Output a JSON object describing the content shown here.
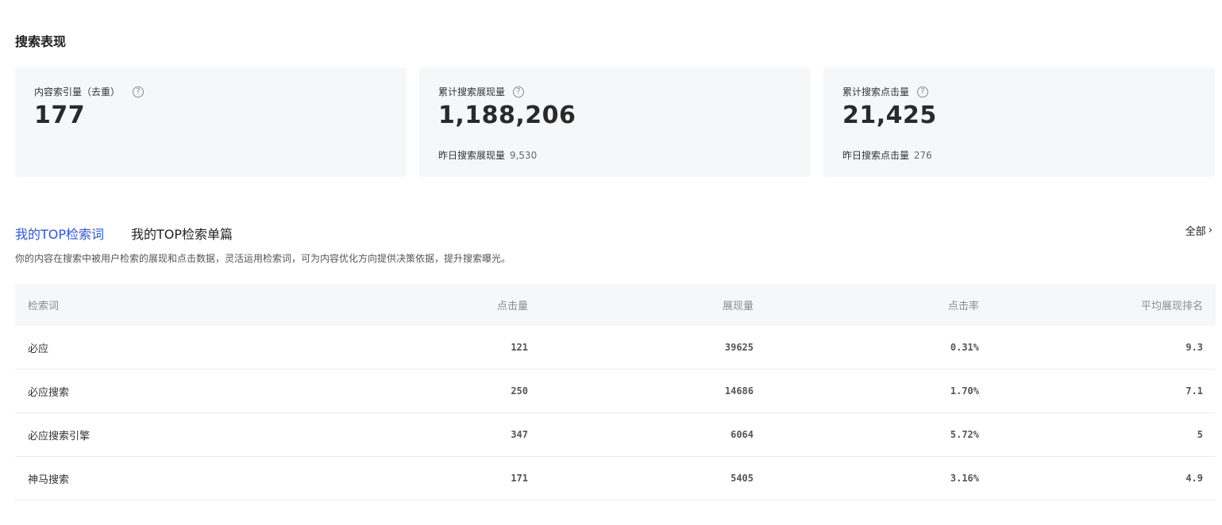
{
  "section_title": "搜索表现",
  "cards": [
    {
      "label": "内容索引量（去重）",
      "value": "177",
      "sub_label": "",
      "sub_value": ""
    },
    {
      "label": "累计搜索展现量",
      "value": "1,188,206",
      "sub_label": "昨日搜索展现量",
      "sub_value": "9,530"
    },
    {
      "label": "累计搜索点击量",
      "value": "21,425",
      "sub_label": "昨日搜索点击量",
      "sub_value": "276"
    }
  ],
  "tabs": [
    {
      "label": "我的TOP检索词",
      "active": true
    },
    {
      "label": "我的TOP检索单篇",
      "active": false
    }
  ],
  "all_link": "全部",
  "description": "你的内容在搜索中被用户检索的展现和点击数据，灵活运用检索词，可为内容优化方向提供决策依据，提升搜索曝光。",
  "table": {
    "headers": [
      "检索词",
      "点击量",
      "展现量",
      "点击率",
      "平均展现排名"
    ],
    "rows": [
      [
        "必应",
        "121",
        "39625",
        "0.31%",
        "9.3"
      ],
      [
        "必应搜索",
        "250",
        "14686",
        "1.70%",
        "7.1"
      ],
      [
        "必应搜索引擎",
        "347",
        "6064",
        "5.72%",
        "5"
      ],
      [
        "神马搜索",
        "171",
        "5405",
        "3.16%",
        "4.9"
      ]
    ]
  },
  "colors": {
    "accent": "#2f56d6",
    "card_bg": "#f6f7f9"
  }
}
